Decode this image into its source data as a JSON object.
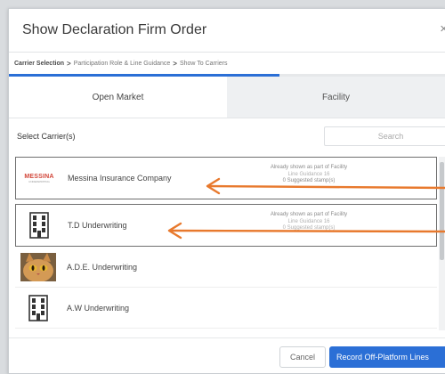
{
  "modal": {
    "title": "Show Declaration Firm Order",
    "close_glyph": "×"
  },
  "breadcrumb": {
    "steps": [
      {
        "label": "Carrier Selection",
        "active": true
      },
      {
        "label": "Participation Role & Line Guidance",
        "active": false
      },
      {
        "label": "Show To Carriers",
        "active": false
      }
    ],
    "separator": ">"
  },
  "progress": {
    "fraction": 0.62,
    "color": "#2b6fd6"
  },
  "tabs": [
    {
      "label": "Open Market",
      "active": true
    },
    {
      "label": "Facility",
      "active": false
    }
  ],
  "select": {
    "label": "Select Carrier(s)",
    "search_placeholder": "Search"
  },
  "carriers": [
    {
      "name": "Messina Insurance Company",
      "logo": "messina-logo",
      "logo_text": "MESSINA",
      "logo_subtext": "UNDERWRITING",
      "status_lines": [
        "Already shown as part of Facility",
        "Line Guidance 16",
        "0 Suggested stamp(s)"
      ]
    },
    {
      "name": "T.D Underwriting",
      "logo": "building-icon",
      "status_lines": [
        "Already shown as part of Facility",
        "Line Guidance 16",
        "0 Suggested stamp(s)"
      ]
    },
    {
      "name": "A.D.E. Underwriting",
      "logo": "cat-photo",
      "status_lines": []
    },
    {
      "name": "A.W Underwriting",
      "logo": "building-icon",
      "status_lines": []
    }
  ],
  "footer": {
    "cancel_label": "Cancel",
    "record_label": "Record Off-Platform Lines"
  },
  "colors": {
    "accent": "#2b6fd6",
    "annotation_arrow": "#e8792d"
  }
}
